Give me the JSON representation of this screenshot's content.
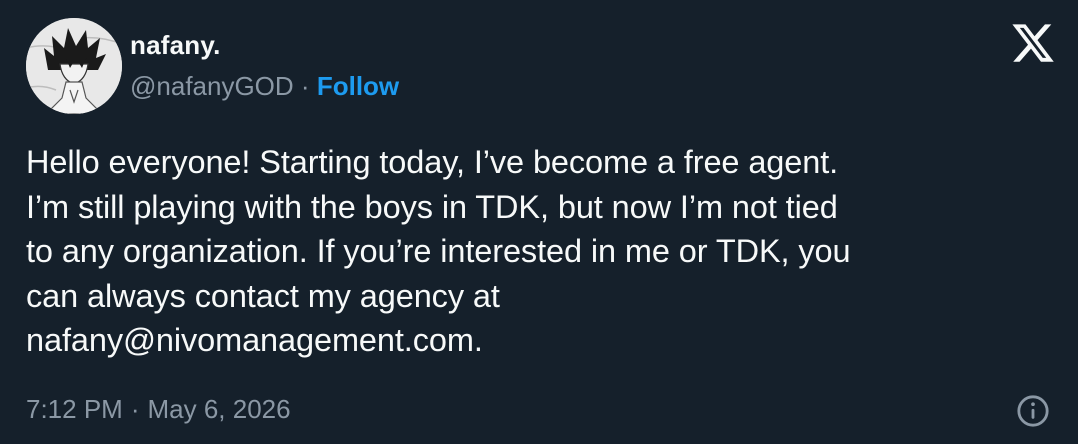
{
  "author": {
    "display_name": "nafany.",
    "handle": "@nafanyGOD",
    "separator": "·",
    "follow_label": "Follow",
    "avatar_icon": "avatar-anime-drawing"
  },
  "brand": {
    "logo_icon": "x-logo-icon"
  },
  "tweet": {
    "text": "Hello everyone! Starting today, I’ve become a free agent.\nI’m still playing with the boys in TDK, but now I’m not tied\nto any organization. If you’re interested in me or TDK, you\ncan always contact my agency at\nnafany@nivomanagement.com.",
    "time": "7:12 PM",
    "separator": "·",
    "date": "May 6, 2026"
  },
  "colors": {
    "background": "#15202b",
    "text_primary": "#f7f9f9",
    "text_secondary": "#8b98a5",
    "accent": "#1d9bf0"
  }
}
